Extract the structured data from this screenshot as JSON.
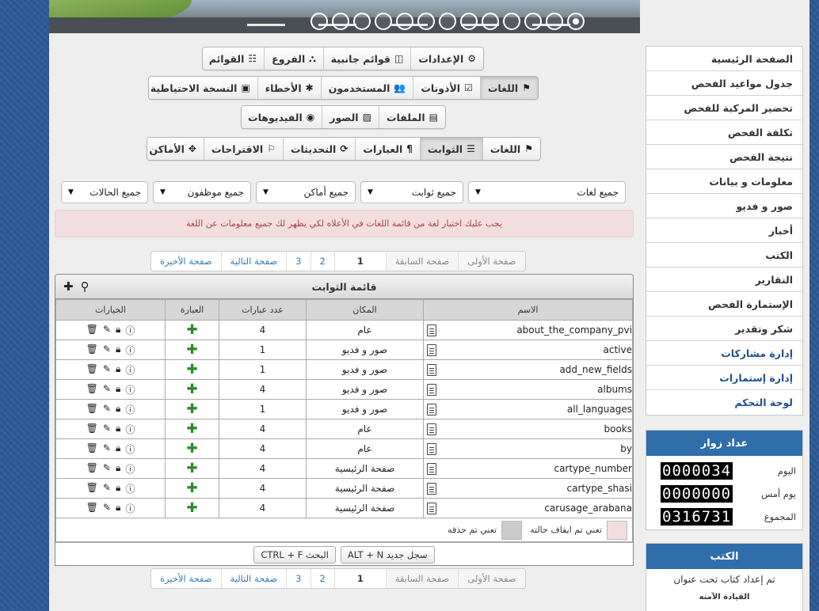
{
  "banner": {
    "dots": 13,
    "active_dot": 0
  },
  "toolbars": {
    "row1": [
      {
        "icon": "⚙",
        "label": "الإعدادات",
        "name": "settings"
      },
      {
        "icon": "◫",
        "label": "قوائم جانبية",
        "name": "side-lists"
      },
      {
        "icon": "⛬",
        "label": "الفروع",
        "name": "branches"
      },
      {
        "icon": "☷",
        "label": "القوائم",
        "name": "lists"
      }
    ],
    "row2": [
      {
        "icon": "⚑",
        "label": "اللغات",
        "name": "languages",
        "active": true
      },
      {
        "icon": "☑",
        "label": "الأذونات",
        "name": "permissions"
      },
      {
        "icon": "👥",
        "label": "المستخدمون",
        "name": "users"
      },
      {
        "icon": "✱",
        "label": "الأخطاء",
        "name": "errors"
      },
      {
        "icon": "▣",
        "label": "النسخة الاحتياطية",
        "name": "backup"
      }
    ],
    "row3": [
      {
        "icon": "▤",
        "label": "الملفات",
        "name": "files"
      },
      {
        "icon": "▨",
        "label": "الصور",
        "name": "images"
      },
      {
        "icon": "◉",
        "label": "الفيديوهات",
        "name": "videos"
      }
    ],
    "row4": [
      {
        "icon": "⚑",
        "label": "اللغات",
        "name": "languages-2"
      },
      {
        "icon": "☰",
        "label": "الثوابت",
        "name": "constants",
        "active": true
      },
      {
        "icon": "¶",
        "label": "العبارات",
        "name": "phrases"
      },
      {
        "icon": "⟳",
        "label": "التحديثات",
        "name": "updates"
      },
      {
        "icon": "⚐",
        "label": "الاقتراحات",
        "name": "suggestions"
      },
      {
        "icon": "✥",
        "label": "الأماكن",
        "name": "places"
      }
    ]
  },
  "filters": [
    "جميع لغات",
    "جميع ثوابت",
    "جميع أماكن",
    "جميع موظفون",
    "جميع الحالات"
  ],
  "alert": "يجب عليك اختيار لغة من قائمة اللغات في الأعلاه لكي يظهر لك جميع معلومات عن اللغة",
  "pagination": {
    "first": "صفحة الأولى",
    "prev": "صفحة السابقة",
    "pages": [
      "1",
      "2",
      "3"
    ],
    "next": "صفحة التالية",
    "last": "صفحة الأخيرة"
  },
  "table": {
    "title": "قائمة الثوابت",
    "headers": {
      "name": "الاسم",
      "place": "المكان",
      "count": "عدد عبارات",
      "phrase": "العبارة",
      "options": "الخيارات"
    },
    "rows": [
      {
        "name": "about_the_company_pvi",
        "place": "عام",
        "count": "4"
      },
      {
        "name": "active",
        "place": "صور و فديو",
        "count": "1"
      },
      {
        "name": "add_new_fields",
        "place": "صور و فديو",
        "count": "1"
      },
      {
        "name": "albums",
        "place": "صور و فديو",
        "count": "4"
      },
      {
        "name": "all_languages",
        "place": "صور و فديو",
        "count": "1"
      },
      {
        "name": "books",
        "place": "عام",
        "count": "4"
      },
      {
        "name": "by",
        "place": "عام",
        "count": "4"
      },
      {
        "name": "cartype_number",
        "place": "صفحة الرئيسية",
        "count": "4"
      },
      {
        "name": "cartype_shasi",
        "place": "صفحة الرئيسية",
        "count": "4"
      },
      {
        "name": "carusage_arabana",
        "place": "صفحة الرئيسية",
        "count": "4"
      }
    ],
    "legend": {
      "stopped": "تعني تم ايقاف حالته",
      "deleted": "تعني تم حذفه",
      "stopped_color": "#f2dede",
      "deleted_color": "#cccccc"
    },
    "footer": {
      "new_record": "ALT + N  سجل جديد",
      "search": "CTRL + F  البحث"
    }
  },
  "sidebar": {
    "menu": [
      {
        "label": "الصفحة الرئيسية",
        "blue": false
      },
      {
        "label": "جدول مواعيد الفحص",
        "blue": false
      },
      {
        "label": "تحضير المركبة للفحص",
        "blue": false
      },
      {
        "label": "تكلفة الفحص",
        "blue": false
      },
      {
        "label": "نتيجة الفحص",
        "blue": false
      },
      {
        "label": "معلومات و بيانات",
        "blue": false
      },
      {
        "label": "صور و فديو",
        "blue": false
      },
      {
        "label": "أخبار",
        "blue": false
      },
      {
        "label": "الكتب",
        "blue": false
      },
      {
        "label": "التقارير",
        "blue": false
      },
      {
        "label": "الإستمارة الفحص",
        "blue": false
      },
      {
        "label": "شكر وتقدير",
        "blue": false
      },
      {
        "label": "إدارة مشاركات",
        "blue": true
      },
      {
        "label": "إدارة إستمارات",
        "blue": true
      },
      {
        "label": "لوحة التحكم",
        "blue": true
      }
    ],
    "visitors": {
      "title": "عداد زوار",
      "rows": [
        {
          "label": "اليوم",
          "value": "0000034"
        },
        {
          "label": "يوم أمس",
          "value": "0000000"
        },
        {
          "label": "المجموع",
          "value": "0316731"
        }
      ]
    },
    "books": {
      "title": "الكتب",
      "item": "تم إعداد كتاب تحت عنوان",
      "subtitle": "القيادة الآمنه"
    }
  },
  "colors": {
    "accent": "#2f6dab",
    "link": "#337ab7",
    "add": "#2e8b2e"
  }
}
